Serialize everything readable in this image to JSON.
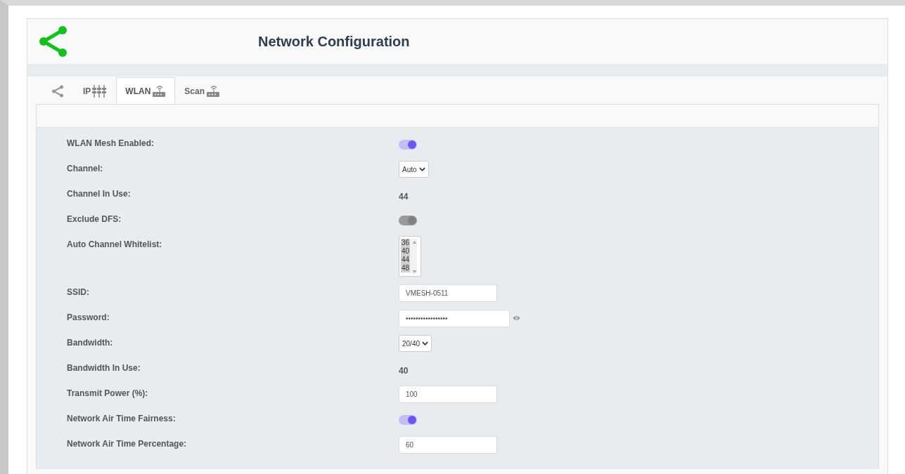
{
  "header": {
    "title": "Network Configuration"
  },
  "tabs": [
    {
      "kind": "share",
      "selected": false
    },
    {
      "kind": "ip",
      "label": "IP",
      "selected": false
    },
    {
      "kind": "router",
      "label": "WLAN",
      "selected": true
    },
    {
      "kind": "router",
      "label": "Scan",
      "selected": false
    }
  ],
  "fields": [
    {
      "kind": "toggle",
      "label": "WLAN Mesh Enabled:",
      "on": true,
      "disabled": false
    },
    {
      "kind": "select",
      "label": "Channel:",
      "value": "Auto"
    },
    {
      "kind": "text",
      "label": "Channel In Use:",
      "value": "44"
    },
    {
      "kind": "toggle",
      "label": "Exclude DFS:",
      "on": true,
      "disabled": true
    },
    {
      "kind": "list",
      "label": "Auto Channel Whitelist:",
      "options": [
        {
          "label": "36",
          "selected": true
        },
        {
          "label": "40",
          "selected": true
        },
        {
          "label": "44",
          "selected": true
        },
        {
          "label": "48",
          "selected": true
        }
      ]
    },
    {
      "kind": "input",
      "label": "SSID:",
      "value": "VMESH-0511"
    },
    {
      "kind": "password",
      "label": "Password:",
      "value": "•••••••••••••••••"
    },
    {
      "kind": "select",
      "label": "Bandwidth:",
      "value": "20/40"
    },
    {
      "kind": "text",
      "label": "Bandwidth In Use:",
      "value": "40"
    },
    {
      "kind": "input",
      "label": "Transmit Power (%):",
      "value": "100"
    },
    {
      "kind": "toggle",
      "label": "Network Air Time Fairness:",
      "on": true,
      "disabled": false
    },
    {
      "kind": "input",
      "label": "Network Air Time Percentage:",
      "value": "60"
    }
  ]
}
